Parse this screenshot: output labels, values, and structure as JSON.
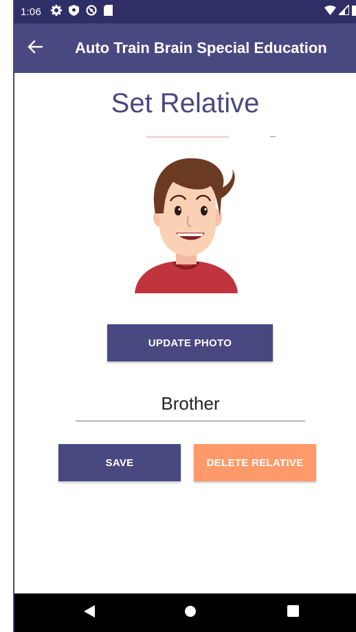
{
  "status_bar": {
    "time": "1:06",
    "icons": [
      "settings-icon",
      "shield-icon",
      "at-sign-icon",
      "sd-card-icon"
    ],
    "right_icons": [
      "wifi-icon",
      "signal-icon",
      "battery-icon"
    ]
  },
  "app_bar": {
    "back_icon": "arrow-left-icon",
    "title": "Auto Train Brain Special Education"
  },
  "page": {
    "title": "Set Relative",
    "update_photo_label": "UPDATE PHOTO",
    "relative_name": "Brother",
    "save_label": "SAVE",
    "delete_label": "DELETE RELATIVE"
  },
  "nav_bar": {
    "icons": [
      "back-triangle-icon",
      "home-circle-icon",
      "recents-square-icon"
    ]
  },
  "colors": {
    "primary": "#4a4881",
    "status_bar": "#2f2e66",
    "delete_button": "#fe9a69",
    "title_text": "#4a4881"
  }
}
